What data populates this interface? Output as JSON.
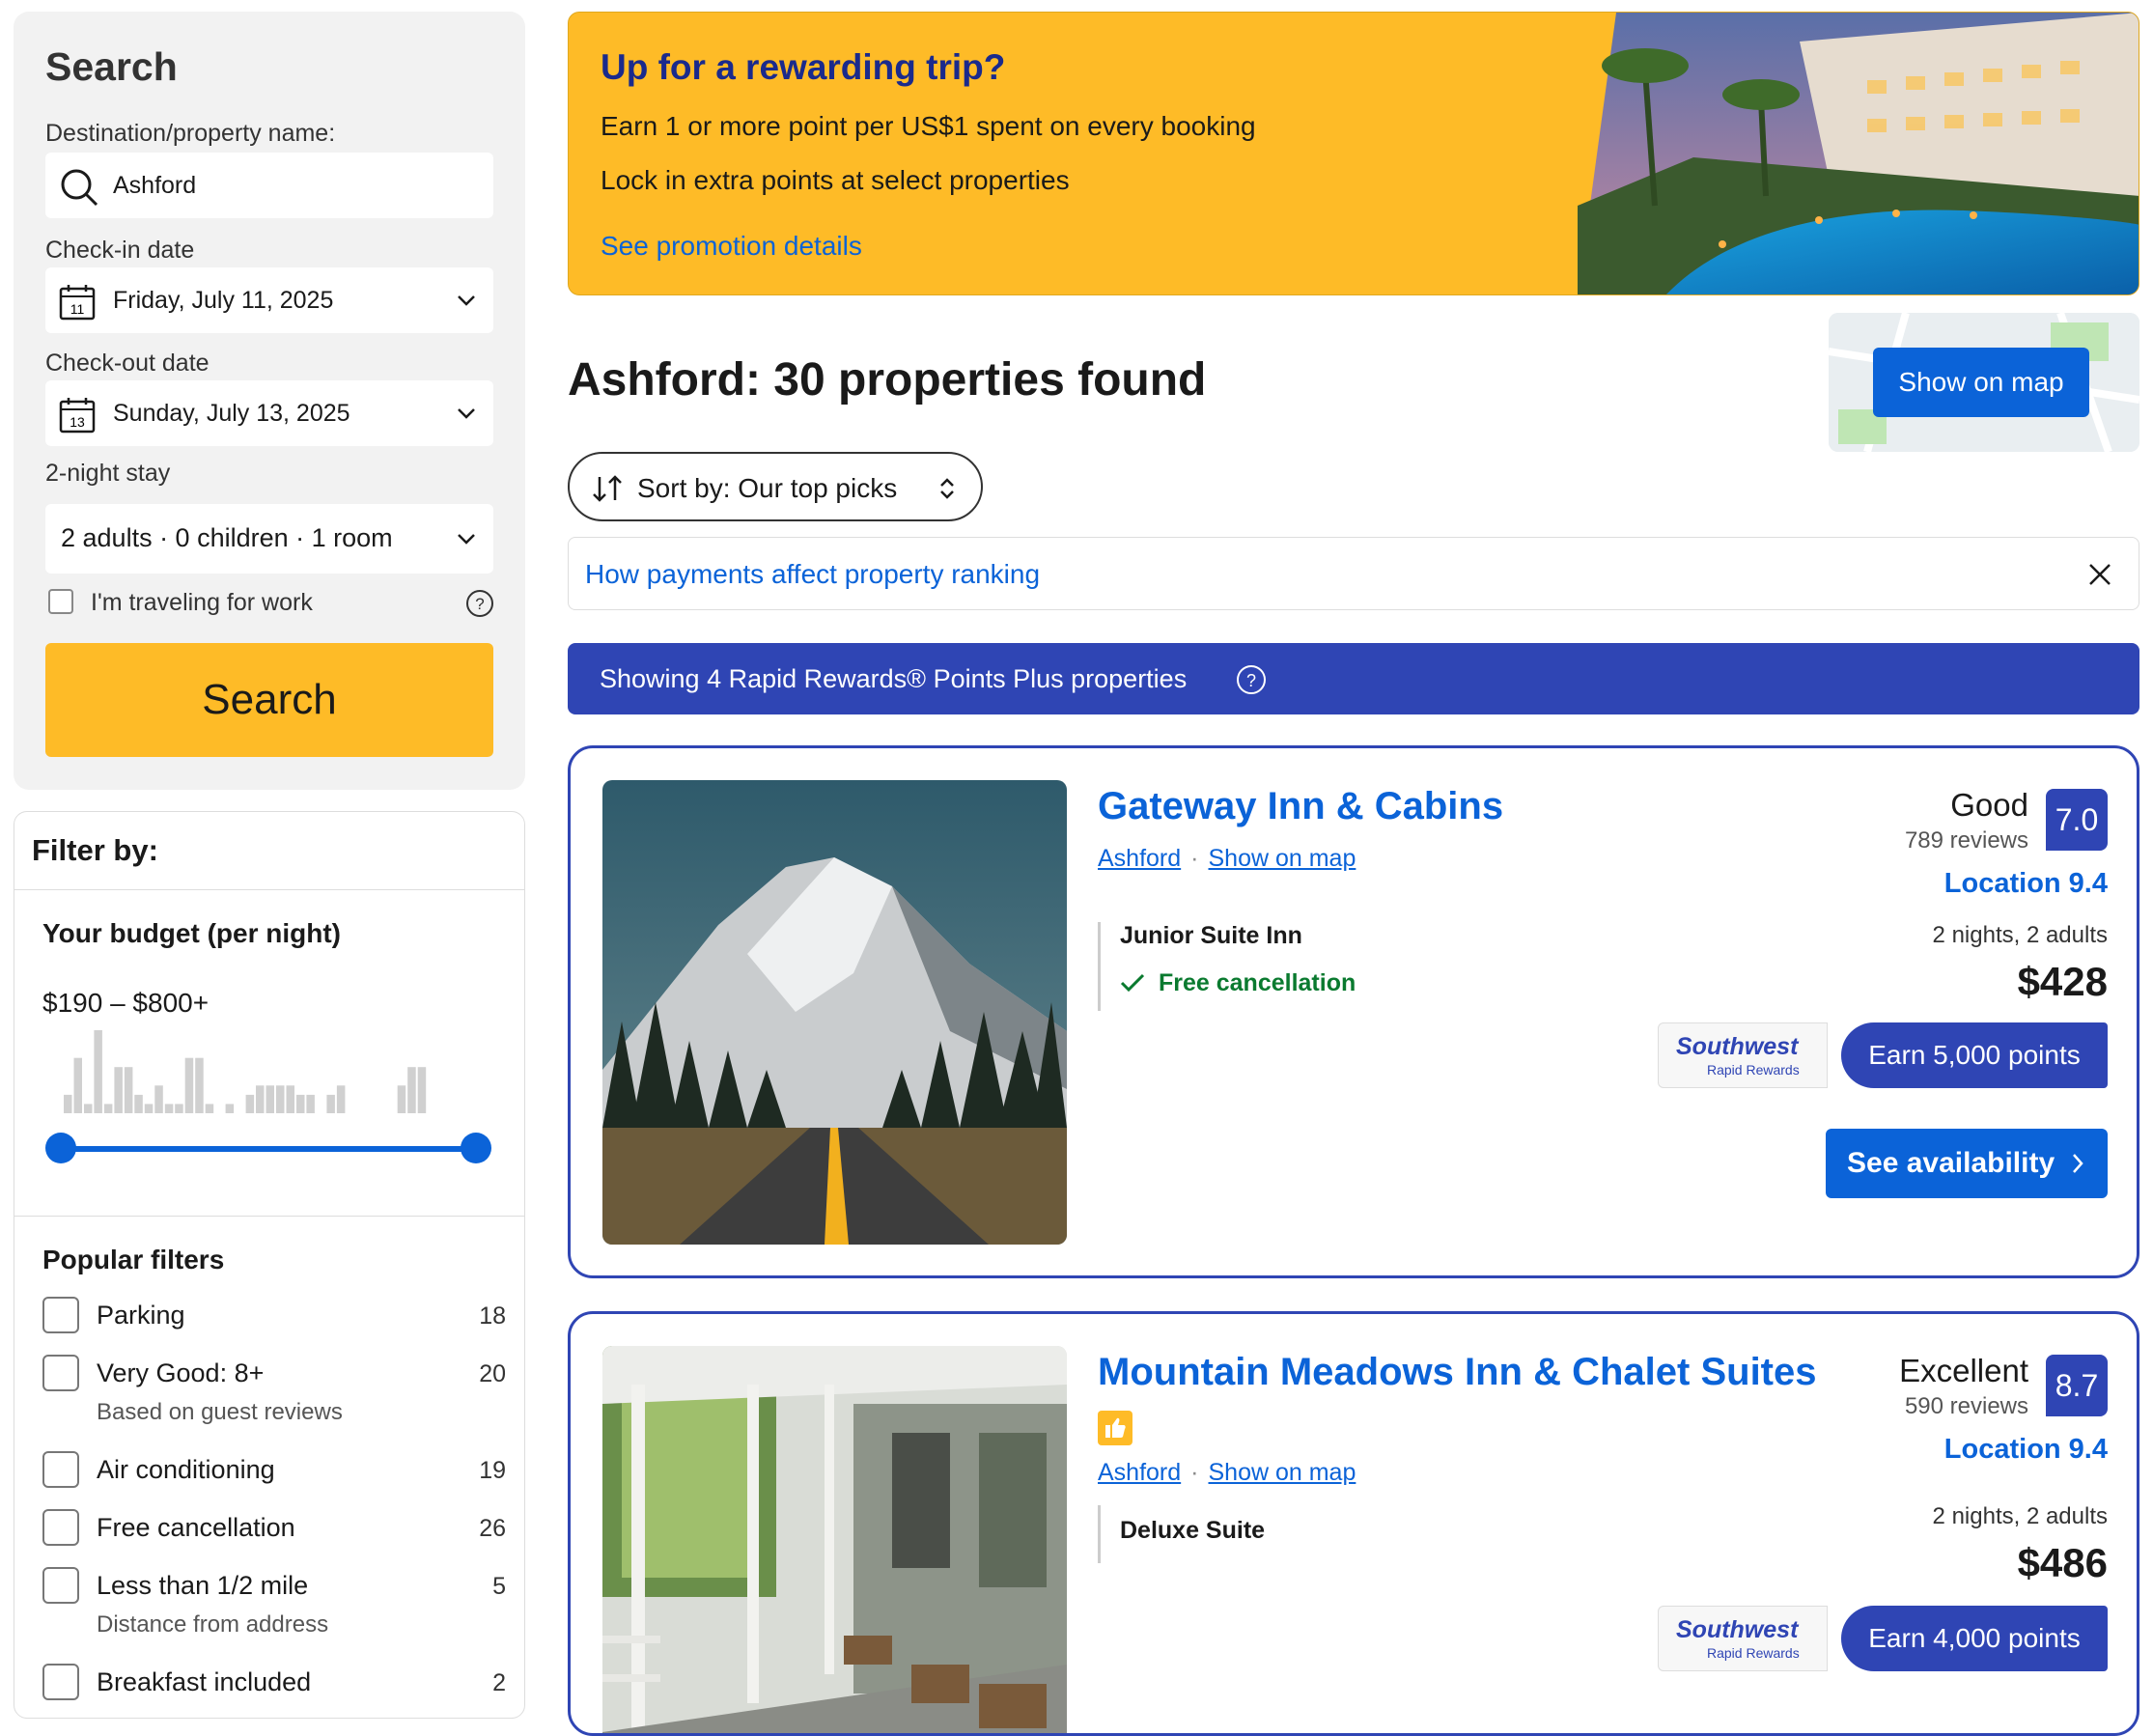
{
  "search": {
    "title": "Search",
    "destination_label": "Destination/property name:",
    "destination_value": "Ashford",
    "checkin_label": "Check-in date",
    "checkin_value": "Friday, July 11, 2025",
    "checkin_day": "11",
    "checkout_label": "Check-out date",
    "checkout_value": "Sunday, July 13, 2025",
    "checkout_day": "13",
    "stay_length": "2-night stay",
    "guests_value": "2 adults · 0 children · 1 room",
    "work_label": "I'm traveling for work",
    "button_label": "Search"
  },
  "filters": {
    "title": "Filter by:",
    "budget_title": "Your budget (per night)",
    "budget_range": "$190 – $800+",
    "budget_min_fraction": 0,
    "budget_max_fraction": 1,
    "histogram": [
      2,
      6,
      1,
      9,
      1,
      5,
      5,
      2,
      1,
      3,
      1,
      1,
      6,
      6,
      1,
      0,
      1,
      0,
      2,
      3,
      3,
      3,
      3,
      2,
      2,
      0,
      2,
      3,
      0,
      0,
      0,
      0,
      0,
      3,
      5,
      5,
      0,
      0,
      0,
      0,
      0,
      0
    ],
    "popular_title": "Popular filters",
    "items": [
      {
        "label": "Parking",
        "count": "18",
        "sub": ""
      },
      {
        "label": "Very Good: 8+",
        "count": "20",
        "sub": "Based on guest reviews"
      },
      {
        "label": "Air conditioning",
        "count": "19",
        "sub": ""
      },
      {
        "label": "Free cancellation",
        "count": "26",
        "sub": ""
      },
      {
        "label": "Less than 1/2 mile",
        "count": "5",
        "sub": "Distance from address"
      },
      {
        "label": "Breakfast included",
        "count": "2",
        "sub": ""
      }
    ]
  },
  "promo": {
    "title": "Up for a rewarding trip?",
    "line1": "Earn 1 or more point per US$1 spent on every booking",
    "line2": "Lock in extra points at select properties",
    "link": "See promotion details"
  },
  "results": {
    "title": "Ashford: 30 properties found",
    "map_button": "Show on map",
    "sort_label": "Sort by: Our top picks",
    "payments_link": "How payments affect property ranking",
    "rr_banner": "Showing 4 Rapid Rewards® Points Plus properties"
  },
  "properties": [
    {
      "name": "Gateway Inn & Cabins",
      "area": "Ashford",
      "map_link": "Show on map",
      "room": "Junior Suite Inn",
      "free_cancellation": "Free cancellation",
      "score_label": "Good",
      "reviews": "789 reviews",
      "score": "7.0",
      "location": "Location 9.4",
      "stay": "2 nights, 2 adults",
      "price": "$428",
      "sw_brand": "Southwest",
      "sw_sub": "Rapid Rewards",
      "points": "Earn 5,000 points",
      "availability": "See availability"
    },
    {
      "name": "Mountain Meadows Inn & Chalet Suites",
      "area": "Ashford",
      "map_link": "Show on map",
      "room": "Deluxe Suite",
      "score_label": "Excellent",
      "reviews": "590 reviews",
      "score": "8.7",
      "location": "Location 9.4",
      "stay": "2 nights, 2 adults",
      "price": "$486",
      "sw_brand": "Southwest",
      "sw_sub": "Rapid Rewards",
      "points": "Earn 4,000 points"
    }
  ],
  "colors": {
    "brand_blue": "#0b63d8",
    "navy": "#2f45b4",
    "yellow": "#febb27",
    "green": "#0a7a2f"
  }
}
